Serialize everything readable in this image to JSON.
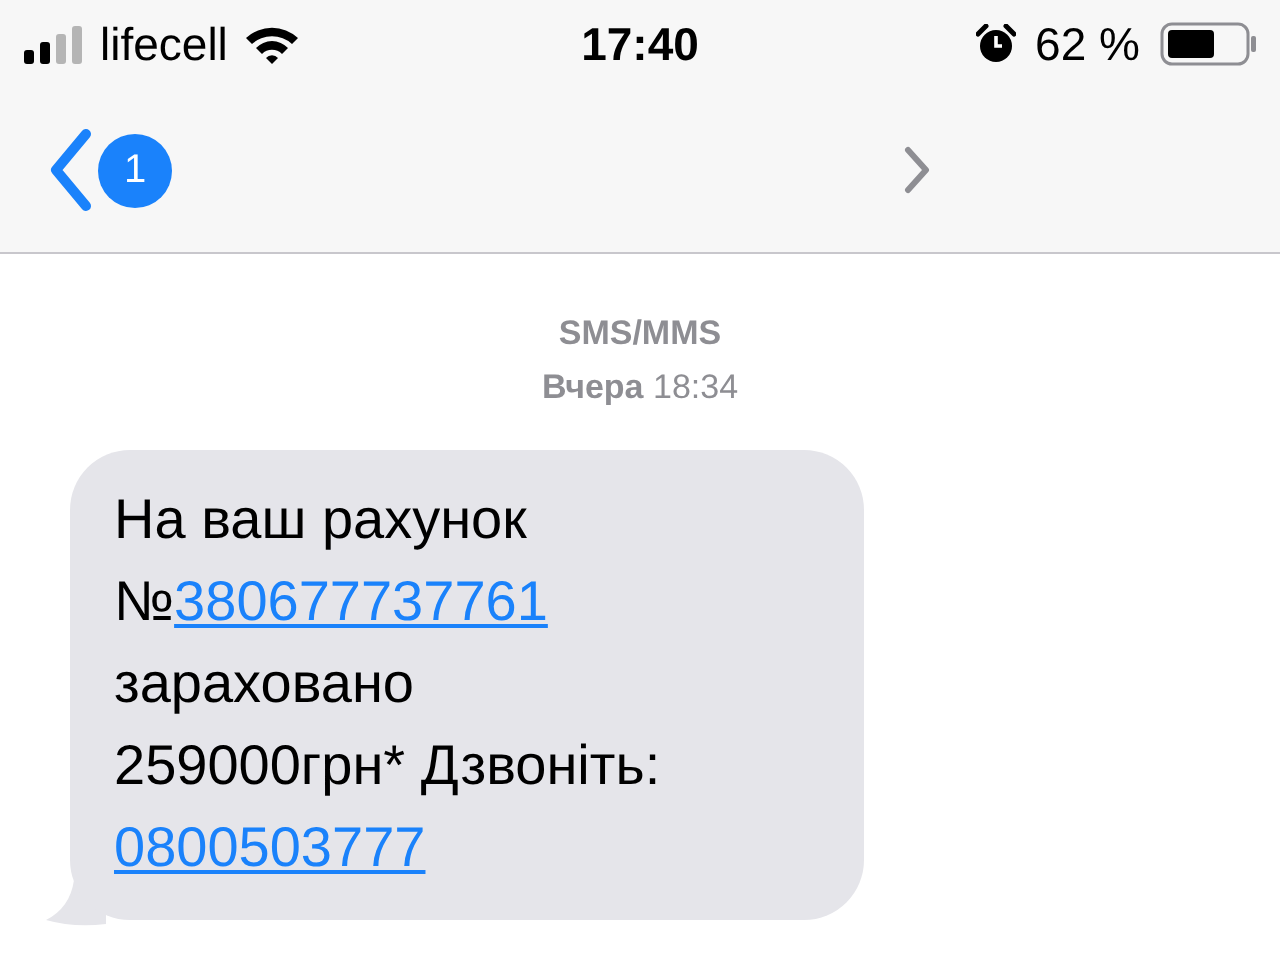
{
  "status_bar": {
    "carrier": "lifecell",
    "time": "17:40",
    "battery": "62 %"
  },
  "nav_bar": {
    "unread_badge": "1"
  },
  "thread": {
    "service": "SMS/MMS",
    "day": "Вчера",
    "time": "18:34"
  },
  "message": {
    "lines": [
      [
        {
          "kind": "text",
          "text": "На ваш рахунок"
        }
      ],
      [
        {
          "kind": "text",
          "text": "№"
        },
        {
          "kind": "link",
          "text": "380677737761"
        }
      ],
      [
        {
          "kind": "text",
          "text": "зараховано"
        }
      ],
      [
        {
          "kind": "text",
          "text": "259000грн* Дзвоніть:"
        }
      ],
      [
        {
          "kind": "link",
          "text": "0800503777"
        }
      ]
    ]
  }
}
